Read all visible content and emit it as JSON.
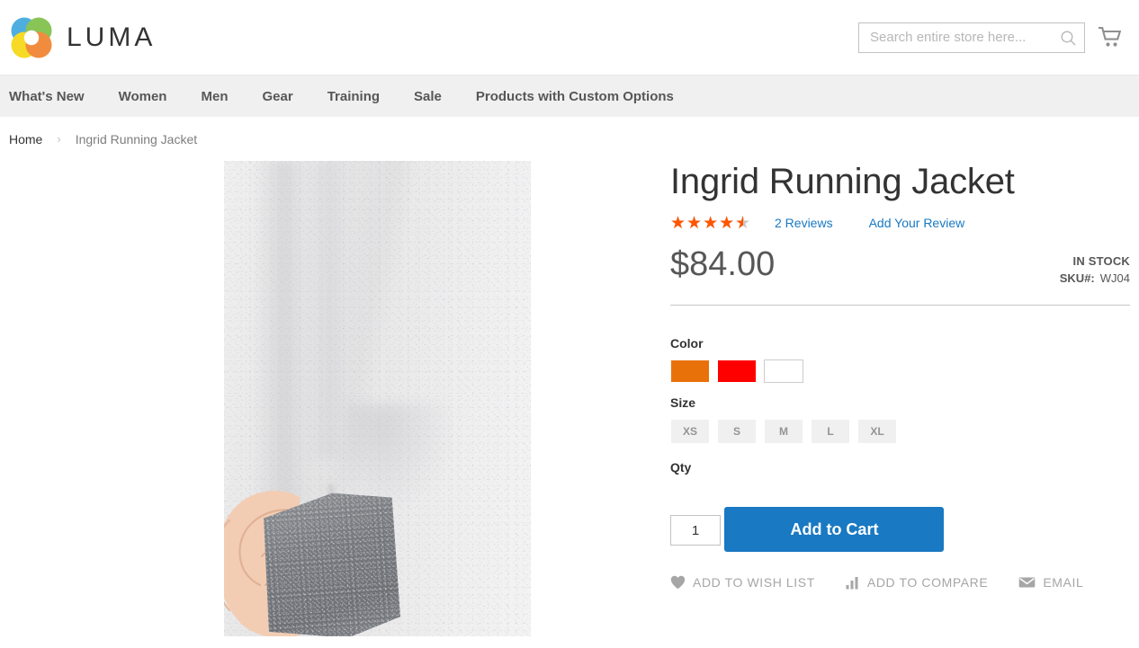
{
  "header": {
    "logo_text": "LUMA",
    "logo_icon": "luma-flower-logo",
    "search": {
      "placeholder": "Search entire store here...",
      "value": "",
      "icon": "search-icon"
    },
    "cart_icon": "shopping-cart-icon"
  },
  "nav": {
    "items": [
      {
        "label": "What's New"
      },
      {
        "label": "Women"
      },
      {
        "label": "Men"
      },
      {
        "label": "Gear"
      },
      {
        "label": "Training"
      },
      {
        "label": "Sale"
      },
      {
        "label": "Products with Custom Options"
      }
    ]
  },
  "breadcrumb": {
    "home": "Home",
    "separator": "›",
    "current": "Ingrid Running Jacket"
  },
  "product": {
    "title": "Ingrid Running Jacket",
    "image_alt": "Ingrid Running Jacket",
    "rating": {
      "value": 4.5,
      "max": 5,
      "percent": 90,
      "stars_glyphs": "★★★★★",
      "reviews_label": "2 Reviews",
      "add_review_label": "Add Your Review"
    },
    "price": "$84.00",
    "stock_status": "IN STOCK",
    "sku_label": "SKU#:",
    "sku_value": "WJ04",
    "options": {
      "color": {
        "label": "Color",
        "values": [
          {
            "name": "Orange",
            "hex": "#e9710a"
          },
          {
            "name": "Red",
            "hex": "#fe0000"
          },
          {
            "name": "White",
            "hex": "#ffffff"
          }
        ]
      },
      "size": {
        "label": "Size",
        "values": [
          {
            "label": "XS"
          },
          {
            "label": "S"
          },
          {
            "label": "M"
          },
          {
            "label": "L"
          },
          {
            "label": "XL"
          }
        ]
      }
    },
    "qty": {
      "label": "Qty",
      "value": "1"
    },
    "add_to_cart_label": "Add to Cart",
    "actions": [
      {
        "label": "ADD TO WISH LIST",
        "icon": "heart-icon"
      },
      {
        "label": "ADD TO COMPARE",
        "icon": "bar-chart-icon"
      },
      {
        "label": "EMAIL",
        "icon": "envelope-icon"
      }
    ]
  },
  "colors": {
    "accent_blue": "#1979c3",
    "star_orange": "#ff5501",
    "nav_bg": "#f0f0f0",
    "text_dark": "#333333",
    "text_gray": "#575757"
  }
}
